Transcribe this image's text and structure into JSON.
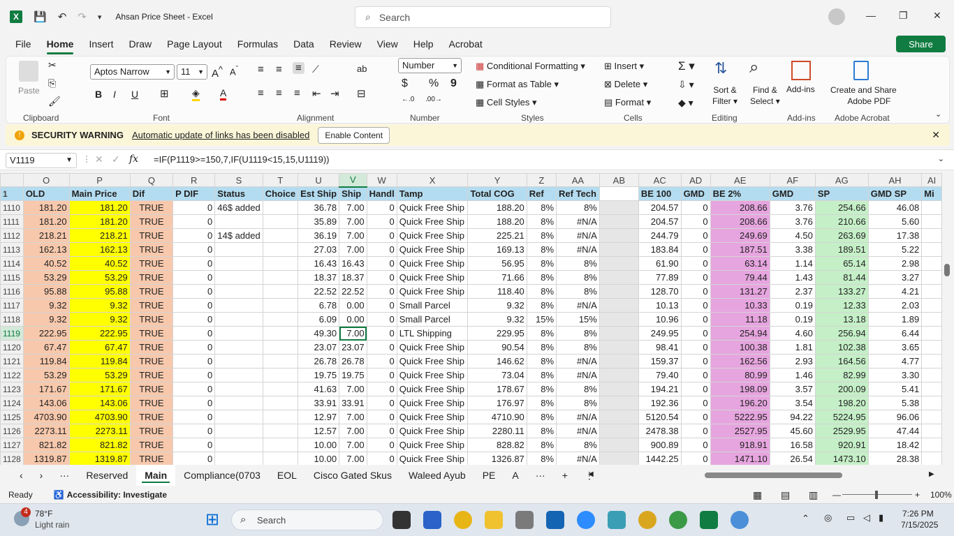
{
  "app": {
    "title": "Ahsan Price Sheet  -  Excel",
    "logo": "X",
    "search_placeholder": "Search"
  },
  "window": {
    "minimize": "—",
    "maximize": "❐",
    "close": "✕"
  },
  "menu": [
    "File",
    "Home",
    "Insert",
    "Draw",
    "Page Layout",
    "Formulas",
    "Data",
    "Review",
    "View",
    "Help",
    "Acrobat"
  ],
  "share_label": "Share",
  "ribbon": {
    "clipboard": {
      "paste": "Paste",
      "label": "Clipboard"
    },
    "font": {
      "name": "Aptos Narrow",
      "size": "11",
      "label": "Font",
      "bold": "B",
      "italic": "I",
      "underline": "U"
    },
    "alignment": {
      "label": "Alignment"
    },
    "number": {
      "format": "Number",
      "currency": "$",
      "percent": "%",
      "comma": "9",
      "label": "Number"
    },
    "styles": {
      "cond": "Conditional Formatting",
      "table": "Format as Table",
      "cell": "Cell Styles",
      "label": "Styles"
    },
    "cells": {
      "insert": "Insert",
      "delete": "Delete",
      "format": "Format",
      "label": "Cells"
    },
    "editing": {
      "sort": "Sort &",
      "sort2": "Filter",
      "find": "Find &",
      "find2": "Select",
      "label": "Editing"
    },
    "addins": {
      "btn": "Add-ins",
      "label": "Add-ins"
    },
    "acrobat": {
      "btn1": "Create and Share",
      "btn2": "Adobe PDF",
      "label": "Adobe Acrobat"
    }
  },
  "security": {
    "title": "SECURITY WARNING",
    "message": "Automatic update of links has been disabled",
    "button": "Enable Content"
  },
  "formula_bar": {
    "name_box": "V1119",
    "fx": "fx",
    "formula": "=IF(P1119>=150,7,IF(U1119<15,15,U1119))"
  },
  "columns": [
    "O",
    "P",
    "Q",
    "R",
    "S",
    "T",
    "U",
    "V",
    "W",
    "X",
    "Y",
    "Z",
    "AA",
    "AB",
    "AC",
    "AD",
    "AE",
    "AF",
    "AG",
    "AH",
    "AI"
  ],
  "header_row": {
    "num": "1",
    "cells": [
      "OLD",
      "Main Price",
      "Dif",
      "P DIF",
      "Status",
      "Choice",
      "Est Ship",
      "Ship",
      "Handl",
      "Tamp",
      "Total COG",
      "Ref",
      "Ref Tech",
      "",
      "BE 100",
      "GMD",
      "BE 2%",
      "GMD",
      "SP",
      "GMD SP",
      "Mi"
    ]
  },
  "rows": [
    {
      "n": "1110",
      "c": [
        "181.20",
        "181.20",
        "TRUE",
        "0",
        "46$ added",
        "",
        "36.78",
        "7.00",
        "0",
        "Quick Free Ship",
        "188.20",
        "8%",
        "8%",
        "",
        "204.57",
        "0",
        "208.66",
        "3.76",
        "254.66",
        "46.08",
        ""
      ]
    },
    {
      "n": "1111",
      "c": [
        "181.20",
        "181.20",
        "TRUE",
        "0",
        "",
        "",
        "35.89",
        "7.00",
        "0",
        "Quick Free Ship",
        "188.20",
        "8%",
        "#N/A",
        "",
        "204.57",
        "0",
        "208.66",
        "3.76",
        "210.66",
        "5.60",
        ""
      ]
    },
    {
      "n": "1112",
      "c": [
        "218.21",
        "218.21",
        "TRUE",
        "0",
        "14$ added",
        "",
        "36.19",
        "7.00",
        "0",
        "Quick Free Ship",
        "225.21",
        "8%",
        "#N/A",
        "",
        "244.79",
        "0",
        "249.69",
        "4.50",
        "263.69",
        "17.38",
        ""
      ]
    },
    {
      "n": "1113",
      "c": [
        "162.13",
        "162.13",
        "TRUE",
        "0",
        "",
        "",
        "27.03",
        "7.00",
        "0",
        "Quick Free Ship",
        "169.13",
        "8%",
        "#N/A",
        "",
        "183.84",
        "0",
        "187.51",
        "3.38",
        "189.51",
        "5.22",
        ""
      ]
    },
    {
      "n": "1114",
      "c": [
        "40.52",
        "40.52",
        "TRUE",
        "0",
        "",
        "",
        "16.43",
        "16.43",
        "0",
        "Quick Free Ship",
        "56.95",
        "8%",
        "8%",
        "",
        "61.90",
        "0",
        "63.14",
        "1.14",
        "65.14",
        "2.98",
        ""
      ]
    },
    {
      "n": "1115",
      "c": [
        "53.29",
        "53.29",
        "TRUE",
        "0",
        "",
        "",
        "18.37",
        "18.37",
        "0",
        "Quick Free Ship",
        "71.66",
        "8%",
        "8%",
        "",
        "77.89",
        "0",
        "79.44",
        "1.43",
        "81.44",
        "3.27",
        ""
      ]
    },
    {
      "n": "1116",
      "c": [
        "95.88",
        "95.88",
        "TRUE",
        "0",
        "",
        "",
        "22.52",
        "22.52",
        "0",
        "Quick Free Ship",
        "118.40",
        "8%",
        "8%",
        "",
        "128.70",
        "0",
        "131.27",
        "2.37",
        "133.27",
        "4.21",
        ""
      ]
    },
    {
      "n": "1117",
      "c": [
        "9.32",
        "9.32",
        "TRUE",
        "0",
        "",
        "",
        "6.78",
        "0.00",
        "0",
        "Small Parcel",
        "9.32",
        "8%",
        "#N/A",
        "",
        "10.13",
        "0",
        "10.33",
        "0.19",
        "12.33",
        "2.03",
        ""
      ]
    },
    {
      "n": "1118",
      "c": [
        "9.32",
        "9.32",
        "TRUE",
        "0",
        "",
        "",
        "6.09",
        "0.00",
        "0",
        "Small Parcel",
        "9.32",
        "15%",
        "15%",
        "",
        "10.96",
        "0",
        "11.18",
        "0.19",
        "13.18",
        "1.89",
        ""
      ]
    },
    {
      "n": "1119",
      "c": [
        "222.95",
        "222.95",
        "TRUE",
        "0",
        "",
        "",
        "49.30",
        "7.00",
        "0",
        "LTL Shipping",
        "229.95",
        "8%",
        "8%",
        "",
        "249.95",
        "0",
        "254.94",
        "4.60",
        "256.94",
        "6.44",
        ""
      ]
    },
    {
      "n": "1120",
      "c": [
        "67.47",
        "67.47",
        "TRUE",
        "0",
        "",
        "",
        "23.07",
        "23.07",
        "0",
        "Quick Free Ship",
        "90.54",
        "8%",
        "8%",
        "",
        "98.41",
        "0",
        "100.38",
        "1.81",
        "102.38",
        "3.65",
        ""
      ]
    },
    {
      "n": "1121",
      "c": [
        "119.84",
        "119.84",
        "TRUE",
        "0",
        "",
        "",
        "26.78",
        "26.78",
        "0",
        "Quick Free Ship",
        "146.62",
        "8%",
        "#N/A",
        "",
        "159.37",
        "0",
        "162.56",
        "2.93",
        "164.56",
        "4.77",
        ""
      ]
    },
    {
      "n": "1122",
      "c": [
        "53.29",
        "53.29",
        "TRUE",
        "0",
        "",
        "",
        "19.75",
        "19.75",
        "0",
        "Quick Free Ship",
        "73.04",
        "8%",
        "#N/A",
        "",
        "79.40",
        "0",
        "80.99",
        "1.46",
        "82.99",
        "3.30",
        ""
      ]
    },
    {
      "n": "1123",
      "c": [
        "171.67",
        "171.67",
        "TRUE",
        "0",
        "",
        "",
        "41.63",
        "7.00",
        "0",
        "Quick Free Ship",
        "178.67",
        "8%",
        "8%",
        "",
        "194.21",
        "0",
        "198.09",
        "3.57",
        "200.09",
        "5.41",
        ""
      ]
    },
    {
      "n": "1124",
      "c": [
        "143.06",
        "143.06",
        "TRUE",
        "0",
        "",
        "",
        "33.91",
        "33.91",
        "0",
        "Quick Free Ship",
        "176.97",
        "8%",
        "8%",
        "",
        "192.36",
        "0",
        "196.20",
        "3.54",
        "198.20",
        "5.38",
        ""
      ]
    },
    {
      "n": "1125",
      "c": [
        "4703.90",
        "4703.90",
        "TRUE",
        "0",
        "",
        "",
        "12.97",
        "7.00",
        "0",
        "Quick Free Ship",
        "4710.90",
        "8%",
        "#N/A",
        "",
        "5120.54",
        "0",
        "5222.95",
        "94.22",
        "5224.95",
        "96.06",
        ""
      ]
    },
    {
      "n": "1126",
      "c": [
        "2273.11",
        "2273.11",
        "TRUE",
        "0",
        "",
        "",
        "12.57",
        "7.00",
        "0",
        "Quick Free Ship",
        "2280.11",
        "8%",
        "#N/A",
        "",
        "2478.38",
        "0",
        "2527.95",
        "45.60",
        "2529.95",
        "47.44",
        ""
      ]
    },
    {
      "n": "1127",
      "c": [
        "821.82",
        "821.82",
        "TRUE",
        "0",
        "",
        "",
        "10.00",
        "7.00",
        "0",
        "Quick Free Ship",
        "828.82",
        "8%",
        "8%",
        "",
        "900.89",
        "0",
        "918.91",
        "16.58",
        "920.91",
        "18.42",
        ""
      ]
    },
    {
      "n": "1128",
      "c": [
        "1319.87",
        "1319.87",
        "TRUE",
        "0",
        "",
        "",
        "10.00",
        "7.00",
        "0",
        "Quick Free Ship",
        "1326.87",
        "8%",
        "#N/A",
        "",
        "1442.25",
        "0",
        "1471.10",
        "26.54",
        "1473.10",
        "28.38",
        ""
      ]
    }
  ],
  "sheet_tabs": [
    "Reserved",
    "Main",
    "Compliance(0703",
    "EOL",
    "Cisco Gated Skus",
    "Waleed Ayub",
    "PE",
    "A"
  ],
  "status": {
    "ready": "Ready",
    "accessibility": "Accessibility: Investigate",
    "zoom": "100%"
  },
  "taskbar": {
    "temp": "78°F",
    "weather": "Light rain",
    "badge": "4",
    "search": "Search",
    "time": "7:26 PM",
    "date": "7/15/2025"
  }
}
